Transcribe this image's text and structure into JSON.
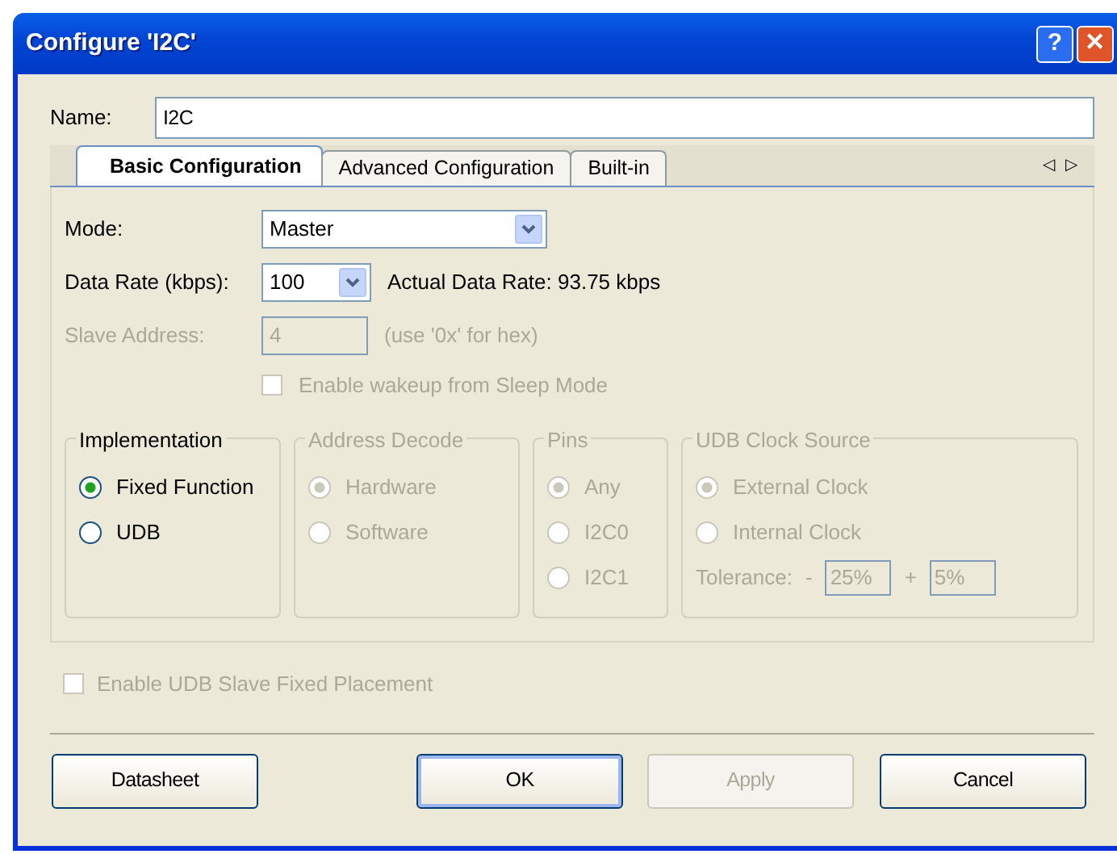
{
  "window": {
    "title": "Configure 'I2C'",
    "title_buttons": [
      {
        "kind": "help",
        "label": "?"
      },
      {
        "kind": "close",
        "label": "✕"
      }
    ]
  },
  "name_field": {
    "label": "Name:",
    "value": "I2C"
  },
  "tabs": [
    {
      "label": "Basic Configuration",
      "selected": true
    },
    {
      "label": "Advanced Configuration",
      "selected": false
    },
    {
      "label": "Built-in",
      "selected": false
    }
  ],
  "tab_scroll": [
    "◁",
    "▷"
  ],
  "settings": [
    {
      "kind": "select",
      "label": "Mode:",
      "value": "Master",
      "disabled": false
    },
    {
      "kind": "select",
      "label": "Data Rate (kbps):",
      "value": "100",
      "disabled": false,
      "note": "Actual Data Rate: 93.75 kbps"
    },
    {
      "kind": "input",
      "label": "Slave Address:",
      "value": "4",
      "disabled": true,
      "note": "(use '0x' for hex)"
    },
    {
      "kind": "checkbox",
      "label": "Enable wakeup from Sleep Mode",
      "checked": false,
      "disabled": true
    }
  ],
  "groups": [
    {
      "title": "Implementation",
      "disabled": false,
      "options": [
        {
          "label": "Fixed Function",
          "selected": true
        },
        {
          "label": "UDB",
          "selected": false
        }
      ]
    },
    {
      "title": "Address Decode",
      "disabled": true,
      "options": [
        {
          "label": "Hardware",
          "selected": true
        },
        {
          "label": "Software",
          "selected": false
        }
      ]
    },
    {
      "title": "Pins",
      "disabled": true,
      "options": [
        {
          "label": "Any",
          "selected": true
        },
        {
          "label": "I2C0",
          "selected": false
        },
        {
          "label": "I2C1",
          "selected": false
        }
      ]
    },
    {
      "title": "UDB Clock Source",
      "disabled": true,
      "options": [
        {
          "label": "External Clock",
          "selected": true
        },
        {
          "label": "Internal Clock",
          "selected": false
        }
      ],
      "tolerance": {
        "label": "Tolerance:",
        "minus": "-",
        "minus_value": "25%",
        "plus": "+",
        "plus_value": "5%"
      }
    }
  ],
  "placement_checkbox": {
    "label": "Enable UDB Slave Fixed Placement",
    "checked": false,
    "disabled": true
  },
  "buttons": [
    {
      "label": "Datasheet",
      "disabled": false,
      "default": false
    },
    {
      "label": "OK",
      "disabled": false,
      "default": true
    },
    {
      "label": "Apply",
      "disabled": true,
      "default": false
    },
    {
      "label": "Cancel",
      "disabled": false,
      "default": false
    }
  ]
}
